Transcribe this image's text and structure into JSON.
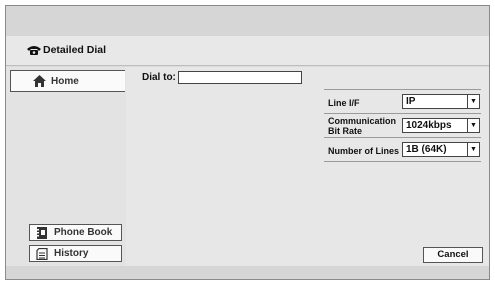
{
  "title": {
    "text": "Detailed Dial",
    "icon": "phone-icon"
  },
  "sidebar": {
    "home": {
      "label": "Home",
      "icon": "home-icon"
    },
    "phone_book": {
      "label": "Phone Book",
      "icon": "phone-book-icon"
    },
    "history": {
      "label": "History",
      "icon": "history-icon"
    }
  },
  "dial": {
    "label": "Dial to:",
    "value": ""
  },
  "settings": [
    {
      "label": "Line I/F",
      "value": "IP"
    },
    {
      "label_line1": "Communication",
      "label_line2": "Bit Rate",
      "value": "1024kbps"
    },
    {
      "label": "Number of Lines",
      "value": "1B (64K)"
    }
  ],
  "cancel_label": "Cancel"
}
